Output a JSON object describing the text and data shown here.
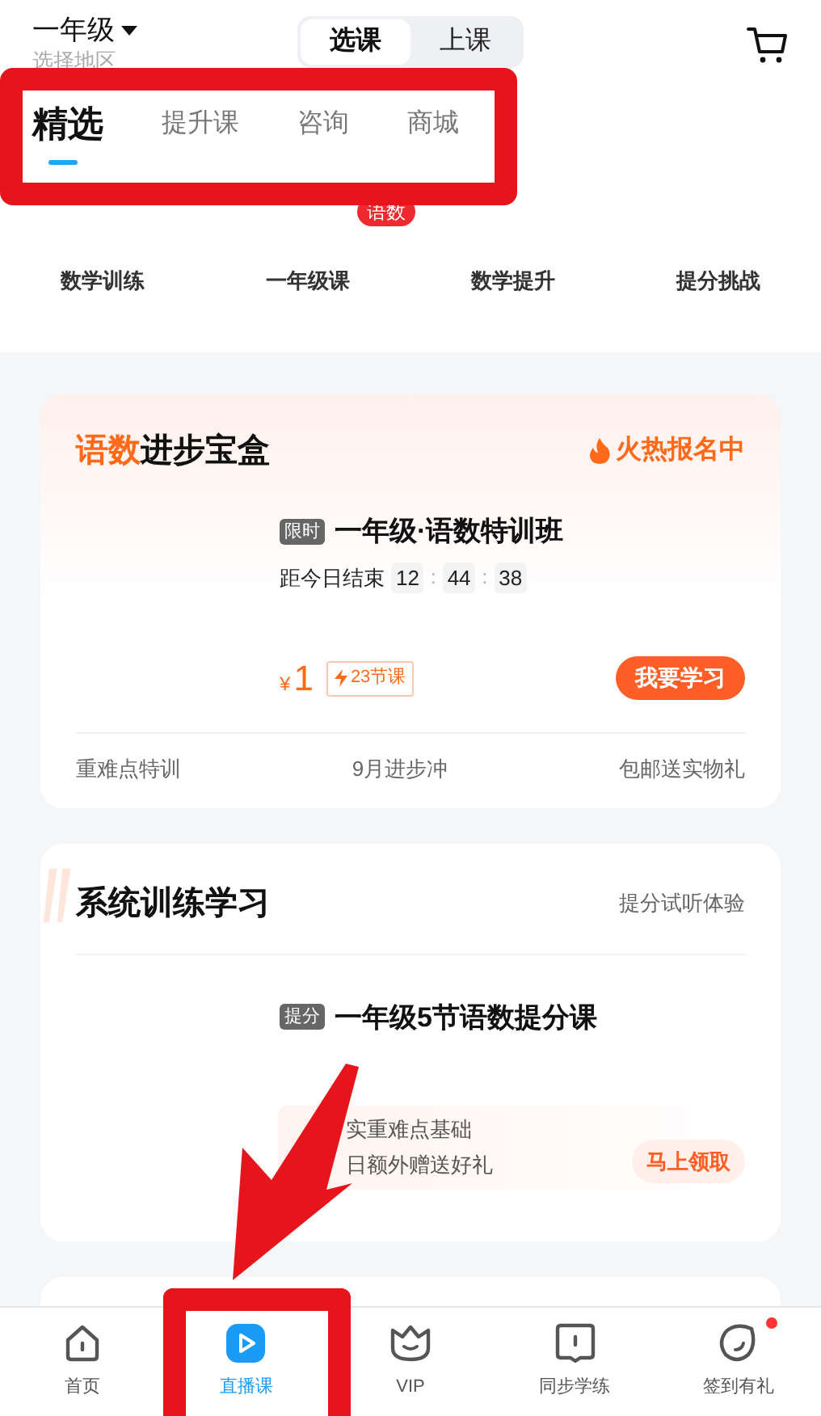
{
  "header": {
    "grade": "一年级",
    "region": "选择地区",
    "segments": [
      {
        "label": "选课",
        "selected": true
      },
      {
        "label": "上课",
        "selected": false
      }
    ]
  },
  "tabs": [
    {
      "label": "精选",
      "selected": true
    },
    {
      "label": "提升课",
      "selected": false
    },
    {
      "label": "咨询",
      "selected": false
    },
    {
      "label": "商城",
      "selected": false
    }
  ],
  "subject_badge": "语数",
  "categories": [
    "数学训练",
    "一年级课",
    "数学提升",
    "提分挑战"
  ],
  "card_1": {
    "title_highlight": "语数",
    "title_rest": "进步宝盒",
    "hot_label": "火热报名中",
    "tag": "限时",
    "course": "一年级·语数特训班",
    "countdown": {
      "label": "距今日结束",
      "parts": [
        "12",
        "44",
        "38"
      ],
      "separators": [
        ":",
        ":"
      ]
    },
    "currency": "¥",
    "price": "1",
    "lessons": "23节课",
    "button": "我要学习",
    "features": [
      "重难点特训",
      "9月进步冲",
      "包邮送实物礼"
    ]
  },
  "card_2": {
    "title": "系统训练学习",
    "subtitle": "提分试听体验",
    "tag": "提分",
    "course": "一年级5节语数提分课",
    "promo_lines": [
      "实重难点基础",
      "日额外赠送好礼"
    ],
    "promo_button": "马上领取"
  },
  "bottom_nav": [
    {
      "label": "首页",
      "selected": false,
      "badge": false
    },
    {
      "label": "直播课",
      "selected": true,
      "badge": false
    },
    {
      "label": "VIP",
      "selected": false,
      "badge": false
    },
    {
      "label": "同步学练",
      "selected": false,
      "badge": false
    },
    {
      "label": "签到有礼",
      "selected": false,
      "badge": true
    }
  ]
}
